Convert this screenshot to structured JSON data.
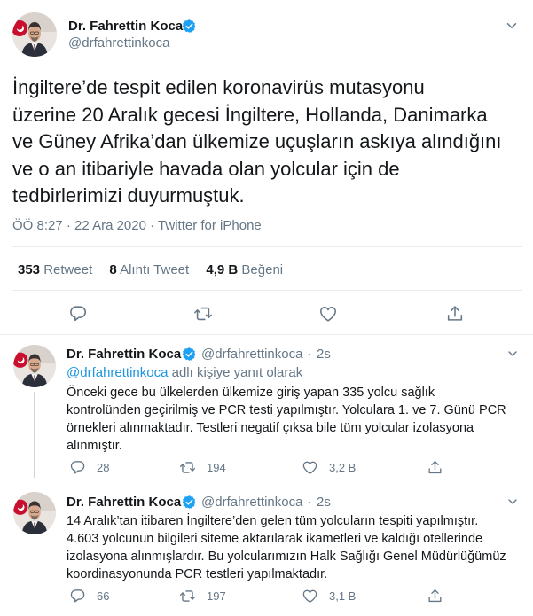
{
  "main_tweet": {
    "display_name": "Dr. Fahrettin Koca",
    "handle": "@drfahrettinkoca",
    "text": "İngiltere’de tespit edilen koronavirüs mutasyonu\nüzerine 20 Aralık gecesi İngiltere, Hollanda, Danimarka\nve Güney Afrika’dan ülkemize uçuşların askıya alındığını\nve o an itibariyle havada olan yolcular için de\ntedbirlerimizi duyurmuştuk.",
    "time": "ÖÖ 8:27",
    "date": "22 Ara 2020",
    "dot": "·",
    "source": "Twitter for iPhone",
    "stats": {
      "retweets": "353",
      "retweets_label": "Retweet",
      "quotes": "8",
      "quotes_label": "Alıntı Tweet",
      "likes": "4,9 B",
      "likes_label": "Beğeni"
    }
  },
  "replies": [
    {
      "display_name": "Dr. Fahrettin Koca",
      "handle": "@drfahrettinkoca",
      "time": "2s",
      "dot": "·",
      "replying_to": "@drfahrettinkoca",
      "replying_suffix": " adlı kişiye yanıt olarak",
      "text": "Önceki gece bu ülkelerden ülkemize giriş yapan 335 yolcu sağlık\nkontrolünden geçirilmiş ve PCR testi yapılmıştır. Yolculara 1. ve 7. Günü PCR\nörnekleri alınmaktadır. Testleri negatif çıksa bile tüm yolcular izolasyona\nalınmıştır.",
      "reply_count": "28",
      "retweet_count": "194",
      "like_count": "3,2 B"
    },
    {
      "display_name": "Dr. Fahrettin Koca",
      "handle": "@drfahrettinkoca",
      "time": "2s",
      "dot": "·",
      "text": "14 Aralık’tan itibaren İngiltere’den gelen tüm yolcuların tespiti yapılmıştır.\n4.603 yolcunun bilgileri siteme aktarılarak ikametleri ve kaldığı otellerinde\nizolasyona alınmışlardır. Bu yolcularımızın Halk Sağlığı Genel Müdürlüğümüz\nkoordinasyonunda PCR testleri yapılmaktadır.",
      "reply_count": "66",
      "retweet_count": "197",
      "like_count": "3,1 B"
    }
  ],
  "colors": {
    "text": "#14171a",
    "secondary": "#657786",
    "link": "#1b95e0",
    "verified": "#1da1f2",
    "border": "#e6ecf0"
  },
  "icons": [
    "avatar",
    "verified-badge-icon",
    "chevron-down-icon",
    "reply-icon",
    "retweet-icon",
    "like-icon",
    "share-icon"
  ]
}
